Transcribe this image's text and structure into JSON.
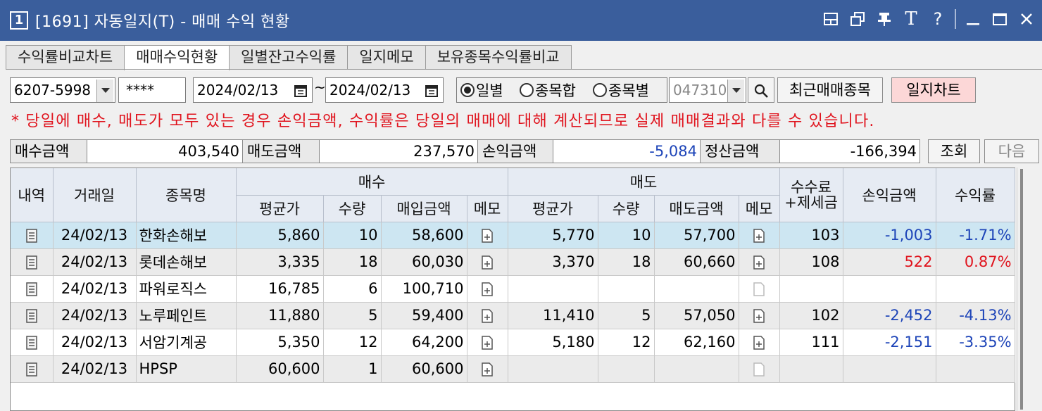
{
  "window": {
    "number": "1",
    "title": "[1691] 자동일지(T) - 매매 수익 현황",
    "buttons": [
      "layout-icon",
      "restore-window-icon",
      "pin-icon",
      "font-icon",
      "help-icon",
      "minimize-icon",
      "maximize-icon",
      "close-icon"
    ],
    "font_label": "T",
    "help_label": "?"
  },
  "tabs": [
    {
      "label": "수익률비교차트",
      "active": false
    },
    {
      "label": "매매수익현황",
      "active": true
    },
    {
      "label": "일별잔고수익률",
      "active": false
    },
    {
      "label": "일지메모",
      "active": false
    },
    {
      "label": "보유종목수익률비교",
      "active": false
    }
  ],
  "toolbar": {
    "account": "6207-5998",
    "password": "****",
    "date_from": "2024/02/13",
    "range_sep": "~",
    "date_to": "2024/02/13",
    "radios": [
      {
        "label": "일별",
        "selected": true
      },
      {
        "label": "종목합",
        "selected": false
      },
      {
        "label": "종목별",
        "selected": false
      }
    ],
    "stock_code": "047310",
    "recent_button": "최근매매종목",
    "chart_button": "일지차트"
  },
  "notice": "* 당일에 매수, 매도가 모두 있는 경우 손익금액, 수익률은 당일의 매매에 대해 계산되므로 실제 매매결과와 다를 수 있습니다.",
  "summary": {
    "buy_label": "매수금액",
    "buy_value": "403,540",
    "sell_label": "매도금액",
    "sell_value": "237,570",
    "pl_label": "손익금액",
    "pl_value": "-5,084",
    "settle_label": "정산금액",
    "settle_value": "-166,394",
    "query_button": "조회",
    "next_button": "다음"
  },
  "grid": {
    "headers": {
      "detail": "내역",
      "date": "거래일",
      "name": "종목명",
      "buy_group": "매수",
      "sell_group": "매도",
      "avg_price": "평균가",
      "qty": "수량",
      "buy_amount": "매입금액",
      "memo": "메모",
      "sell_amount": "매도금액",
      "fee_line1": "수수료",
      "fee_line2": "+제세금",
      "pl": "손익금액",
      "rate": "수익률"
    },
    "rows": [
      {
        "date": "24/02/13",
        "name": "한화손해보",
        "buy_avg": "5,860",
        "buy_qty": "10",
        "buy_amt": "58,600",
        "sell_avg": "5,770",
        "sell_qty": "10",
        "sell_amt": "57,700",
        "fee": "103",
        "pl": "-1,003",
        "rate": "-1.71%",
        "sign": "neg",
        "sell_memo": true
      },
      {
        "date": "24/02/13",
        "name": "롯데손해보",
        "buy_avg": "3,335",
        "buy_qty": "18",
        "buy_amt": "60,030",
        "sell_avg": "3,370",
        "sell_qty": "18",
        "sell_amt": "60,660",
        "fee": "108",
        "pl": "522",
        "rate": "0.87%",
        "sign": "pos",
        "sell_memo": true
      },
      {
        "date": "24/02/13",
        "name": "파워로직스",
        "buy_avg": "16,785",
        "buy_qty": "6",
        "buy_amt": "100,710",
        "sell_avg": "",
        "sell_qty": "",
        "sell_amt": "",
        "fee": "",
        "pl": "",
        "rate": "",
        "sign": "",
        "sell_memo": false
      },
      {
        "date": "24/02/13",
        "name": "노루페인트",
        "buy_avg": "11,880",
        "buy_qty": "5",
        "buy_amt": "59,400",
        "sell_avg": "11,410",
        "sell_qty": "5",
        "sell_amt": "57,050",
        "fee": "102",
        "pl": "-2,452",
        "rate": "-4.13%",
        "sign": "neg",
        "sell_memo": true
      },
      {
        "date": "24/02/13",
        "name": "서암기계공",
        "buy_avg": "5,350",
        "buy_qty": "12",
        "buy_amt": "64,200",
        "sell_avg": "5,180",
        "sell_qty": "12",
        "sell_amt": "62,160",
        "fee": "111",
        "pl": "-2,151",
        "rate": "-3.35%",
        "sign": "neg",
        "sell_memo": true
      },
      {
        "date": "24/02/13",
        "name": "HPSP",
        "buy_avg": "60,600",
        "buy_qty": "1",
        "buy_amt": "60,600",
        "sell_avg": "",
        "sell_qty": "",
        "sell_amt": "",
        "fee": "",
        "pl": "",
        "rate": "",
        "sign": "",
        "sell_memo": false
      }
    ]
  },
  "colors": {
    "title_bg": "#3a5e9c",
    "negative": "#1d44b8",
    "positive": "#e0141e",
    "selected_row": "#cde6f2",
    "chart_button_bg": "#fcd7d7"
  }
}
